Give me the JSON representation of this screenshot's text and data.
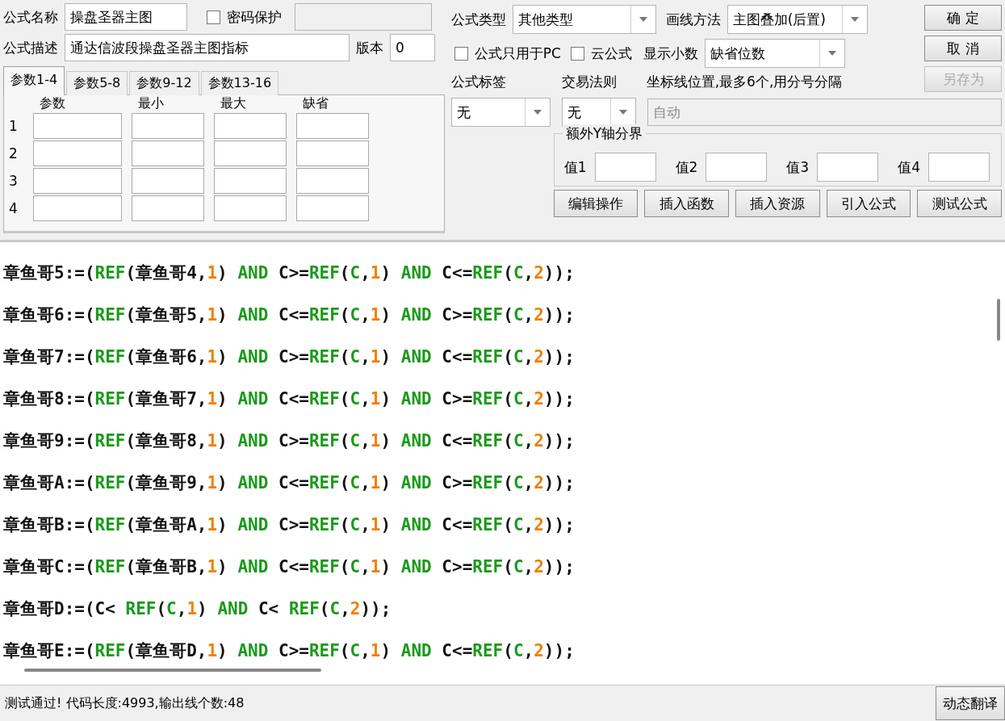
{
  "formula_name": {
    "label": "公式名称",
    "value": "操盘圣器主图"
  },
  "password": {
    "label": "密码保护",
    "checked": false,
    "disabled": true
  },
  "description": {
    "label": "公式描述",
    "value": "通达信波段操盘圣器主图指标"
  },
  "version": {
    "label": "版本",
    "value": "0"
  },
  "tabs": [
    {
      "label": "参数1-4",
      "selected": true
    },
    {
      "label": "参数5-8",
      "selected": false
    },
    {
      "label": "参数9-12",
      "selected": false
    },
    {
      "label": "参数13-16",
      "selected": false
    }
  ],
  "param_columns": [
    "参数",
    "最小",
    "最大",
    "缺省"
  ],
  "param_rows": [
    {
      "index": "1"
    },
    {
      "index": "2"
    },
    {
      "index": "3"
    },
    {
      "index": "4"
    }
  ],
  "formula_type": {
    "label": "公式类型",
    "value": "其他类型"
  },
  "draw_method": {
    "label": "画线方法",
    "value": "主图叠加(后置)"
  },
  "options": [
    {
      "label": "公式只用于PC",
      "checked": false
    },
    {
      "label": "云公式",
      "checked": false
    }
  ],
  "decimals": {
    "label": "显示小数",
    "value": "缺省位数"
  },
  "dialog_buttons": [
    {
      "label": "确 定",
      "disabled": false
    },
    {
      "label": "取 消",
      "disabled": false
    },
    {
      "label": "另存为",
      "disabled": true
    }
  ],
  "formula_tag": {
    "label": "公式标签",
    "value": "无"
  },
  "trade_rule": {
    "label": "交易法则",
    "value": "无"
  },
  "axis_lines": {
    "label": "坐标线位置,最多6个,用分号分隔",
    "placeholder": "自动",
    "disabled": true
  },
  "y_bounds": {
    "title": "额外Y轴分界",
    "fields": [
      {
        "label": "值1"
      },
      {
        "label": "值2"
      },
      {
        "label": "值3"
      },
      {
        "label": "值4"
      }
    ]
  },
  "tool_buttons": [
    "编辑操作",
    "插入函数",
    "插入资源",
    "引入公式",
    "测试公式"
  ],
  "code_lines": [
    {
      "segments": [
        {
          "kind": "plain",
          "text": "章鱼哥5:=("
        },
        {
          "kind": "func",
          "text": "REF"
        },
        {
          "kind": "plain",
          "text": "(章鱼哥4,"
        },
        {
          "kind": "num",
          "text": "1"
        },
        {
          "kind": "plain",
          "text": ") "
        },
        {
          "kind": "func",
          "text": "AND"
        },
        {
          "kind": "plain",
          "text": " C>="
        },
        {
          "kind": "func",
          "text": "REF"
        },
        {
          "kind": "plain",
          "text": "("
        },
        {
          "kind": "func",
          "text": "C"
        },
        {
          "kind": "plain",
          "text": ","
        },
        {
          "kind": "num",
          "text": "1"
        },
        {
          "kind": "plain",
          "text": ") "
        },
        {
          "kind": "func",
          "text": "AND"
        },
        {
          "kind": "plain",
          "text": " C<="
        },
        {
          "kind": "func",
          "text": "REF"
        },
        {
          "kind": "plain",
          "text": "("
        },
        {
          "kind": "func",
          "text": "C"
        },
        {
          "kind": "plain",
          "text": ","
        },
        {
          "kind": "num",
          "text": "2"
        },
        {
          "kind": "plain",
          "text": "));"
        }
      ]
    },
    {
      "segments": [
        {
          "kind": "plain",
          "text": "章鱼哥6:=("
        },
        {
          "kind": "func",
          "text": "REF"
        },
        {
          "kind": "plain",
          "text": "(章鱼哥5,"
        },
        {
          "kind": "num",
          "text": "1"
        },
        {
          "kind": "plain",
          "text": ") "
        },
        {
          "kind": "func",
          "text": "AND"
        },
        {
          "kind": "plain",
          "text": " C<="
        },
        {
          "kind": "func",
          "text": "REF"
        },
        {
          "kind": "plain",
          "text": "("
        },
        {
          "kind": "func",
          "text": "C"
        },
        {
          "kind": "plain",
          "text": ","
        },
        {
          "kind": "num",
          "text": "1"
        },
        {
          "kind": "plain",
          "text": ") "
        },
        {
          "kind": "func",
          "text": "AND"
        },
        {
          "kind": "plain",
          "text": " C>="
        },
        {
          "kind": "func",
          "text": "REF"
        },
        {
          "kind": "plain",
          "text": "("
        },
        {
          "kind": "func",
          "text": "C"
        },
        {
          "kind": "plain",
          "text": ","
        },
        {
          "kind": "num",
          "text": "2"
        },
        {
          "kind": "plain",
          "text": "));"
        }
      ]
    },
    {
      "segments": [
        {
          "kind": "plain",
          "text": "章鱼哥7:=("
        },
        {
          "kind": "func",
          "text": "REF"
        },
        {
          "kind": "plain",
          "text": "(章鱼哥6,"
        },
        {
          "kind": "num",
          "text": "1"
        },
        {
          "kind": "plain",
          "text": ") "
        },
        {
          "kind": "func",
          "text": "AND"
        },
        {
          "kind": "plain",
          "text": " C>="
        },
        {
          "kind": "func",
          "text": "REF"
        },
        {
          "kind": "plain",
          "text": "("
        },
        {
          "kind": "func",
          "text": "C"
        },
        {
          "kind": "plain",
          "text": ","
        },
        {
          "kind": "num",
          "text": "1"
        },
        {
          "kind": "plain",
          "text": ") "
        },
        {
          "kind": "func",
          "text": "AND"
        },
        {
          "kind": "plain",
          "text": " C<="
        },
        {
          "kind": "func",
          "text": "REF"
        },
        {
          "kind": "plain",
          "text": "("
        },
        {
          "kind": "func",
          "text": "C"
        },
        {
          "kind": "plain",
          "text": ","
        },
        {
          "kind": "num",
          "text": "2"
        },
        {
          "kind": "plain",
          "text": "));"
        }
      ]
    },
    {
      "segments": [
        {
          "kind": "plain",
          "text": "章鱼哥8:=("
        },
        {
          "kind": "func",
          "text": "REF"
        },
        {
          "kind": "plain",
          "text": "(章鱼哥7,"
        },
        {
          "kind": "num",
          "text": "1"
        },
        {
          "kind": "plain",
          "text": ") "
        },
        {
          "kind": "func",
          "text": "AND"
        },
        {
          "kind": "plain",
          "text": " C<="
        },
        {
          "kind": "func",
          "text": "REF"
        },
        {
          "kind": "plain",
          "text": "("
        },
        {
          "kind": "func",
          "text": "C"
        },
        {
          "kind": "plain",
          "text": ","
        },
        {
          "kind": "num",
          "text": "1"
        },
        {
          "kind": "plain",
          "text": ") "
        },
        {
          "kind": "func",
          "text": "AND"
        },
        {
          "kind": "plain",
          "text": " C>="
        },
        {
          "kind": "func",
          "text": "REF"
        },
        {
          "kind": "plain",
          "text": "("
        },
        {
          "kind": "func",
          "text": "C"
        },
        {
          "kind": "plain",
          "text": ","
        },
        {
          "kind": "num",
          "text": "2"
        },
        {
          "kind": "plain",
          "text": "));"
        }
      ]
    },
    {
      "segments": [
        {
          "kind": "plain",
          "text": "章鱼哥9:=("
        },
        {
          "kind": "func",
          "text": "REF"
        },
        {
          "kind": "plain",
          "text": "(章鱼哥8,"
        },
        {
          "kind": "num",
          "text": "1"
        },
        {
          "kind": "plain",
          "text": ") "
        },
        {
          "kind": "func",
          "text": "AND"
        },
        {
          "kind": "plain",
          "text": " C>="
        },
        {
          "kind": "func",
          "text": "REF"
        },
        {
          "kind": "plain",
          "text": "("
        },
        {
          "kind": "func",
          "text": "C"
        },
        {
          "kind": "plain",
          "text": ","
        },
        {
          "kind": "num",
          "text": "1"
        },
        {
          "kind": "plain",
          "text": ") "
        },
        {
          "kind": "func",
          "text": "AND"
        },
        {
          "kind": "plain",
          "text": " C<="
        },
        {
          "kind": "func",
          "text": "REF"
        },
        {
          "kind": "plain",
          "text": "("
        },
        {
          "kind": "func",
          "text": "C"
        },
        {
          "kind": "plain",
          "text": ","
        },
        {
          "kind": "num",
          "text": "2"
        },
        {
          "kind": "plain",
          "text": "));"
        }
      ]
    },
    {
      "segments": [
        {
          "kind": "plain",
          "text": "章鱼哥A:=("
        },
        {
          "kind": "func",
          "text": "REF"
        },
        {
          "kind": "plain",
          "text": "(章鱼哥9,"
        },
        {
          "kind": "num",
          "text": "1"
        },
        {
          "kind": "plain",
          "text": ") "
        },
        {
          "kind": "func",
          "text": "AND"
        },
        {
          "kind": "plain",
          "text": " C<="
        },
        {
          "kind": "func",
          "text": "REF"
        },
        {
          "kind": "plain",
          "text": "("
        },
        {
          "kind": "func",
          "text": "C"
        },
        {
          "kind": "plain",
          "text": ","
        },
        {
          "kind": "num",
          "text": "1"
        },
        {
          "kind": "plain",
          "text": ") "
        },
        {
          "kind": "func",
          "text": "AND"
        },
        {
          "kind": "plain",
          "text": " C>="
        },
        {
          "kind": "func",
          "text": "REF"
        },
        {
          "kind": "plain",
          "text": "("
        },
        {
          "kind": "func",
          "text": "C"
        },
        {
          "kind": "plain",
          "text": ","
        },
        {
          "kind": "num",
          "text": "2"
        },
        {
          "kind": "plain",
          "text": "));"
        }
      ]
    },
    {
      "segments": [
        {
          "kind": "plain",
          "text": "章鱼哥B:=("
        },
        {
          "kind": "func",
          "text": "REF"
        },
        {
          "kind": "plain",
          "text": "(章鱼哥A,"
        },
        {
          "kind": "num",
          "text": "1"
        },
        {
          "kind": "plain",
          "text": ") "
        },
        {
          "kind": "func",
          "text": "AND"
        },
        {
          "kind": "plain",
          "text": " C>="
        },
        {
          "kind": "func",
          "text": "REF"
        },
        {
          "kind": "plain",
          "text": "("
        },
        {
          "kind": "func",
          "text": "C"
        },
        {
          "kind": "plain",
          "text": ","
        },
        {
          "kind": "num",
          "text": "1"
        },
        {
          "kind": "plain",
          "text": ") "
        },
        {
          "kind": "func",
          "text": "AND"
        },
        {
          "kind": "plain",
          "text": " C<="
        },
        {
          "kind": "func",
          "text": "REF"
        },
        {
          "kind": "plain",
          "text": "("
        },
        {
          "kind": "func",
          "text": "C"
        },
        {
          "kind": "plain",
          "text": ","
        },
        {
          "kind": "num",
          "text": "2"
        },
        {
          "kind": "plain",
          "text": "));"
        }
      ]
    },
    {
      "segments": [
        {
          "kind": "plain",
          "text": "章鱼哥C:=("
        },
        {
          "kind": "func",
          "text": "REF"
        },
        {
          "kind": "plain",
          "text": "(章鱼哥B,"
        },
        {
          "kind": "num",
          "text": "1"
        },
        {
          "kind": "plain",
          "text": ") "
        },
        {
          "kind": "func",
          "text": "AND"
        },
        {
          "kind": "plain",
          "text": " C<="
        },
        {
          "kind": "func",
          "text": "REF"
        },
        {
          "kind": "plain",
          "text": "("
        },
        {
          "kind": "func",
          "text": "C"
        },
        {
          "kind": "plain",
          "text": ","
        },
        {
          "kind": "num",
          "text": "1"
        },
        {
          "kind": "plain",
          "text": ") "
        },
        {
          "kind": "func",
          "text": "AND"
        },
        {
          "kind": "plain",
          "text": " C>="
        },
        {
          "kind": "func",
          "text": "REF"
        },
        {
          "kind": "plain",
          "text": "("
        },
        {
          "kind": "func",
          "text": "C"
        },
        {
          "kind": "plain",
          "text": ","
        },
        {
          "kind": "num",
          "text": "2"
        },
        {
          "kind": "plain",
          "text": "));"
        }
      ]
    },
    {
      "segments": [
        {
          "kind": "plain",
          "text": "章鱼哥D:=(C< "
        },
        {
          "kind": "func",
          "text": "REF"
        },
        {
          "kind": "plain",
          "text": "("
        },
        {
          "kind": "func",
          "text": "C"
        },
        {
          "kind": "plain",
          "text": ","
        },
        {
          "kind": "num",
          "text": "1"
        },
        {
          "kind": "plain",
          "text": ") "
        },
        {
          "kind": "func",
          "text": "AND"
        },
        {
          "kind": "plain",
          "text": " C< "
        },
        {
          "kind": "func",
          "text": "REF"
        },
        {
          "kind": "plain",
          "text": "("
        },
        {
          "kind": "func",
          "text": "C"
        },
        {
          "kind": "plain",
          "text": ","
        },
        {
          "kind": "num",
          "text": "2"
        },
        {
          "kind": "plain",
          "text": "));"
        }
      ]
    },
    {
      "segments": [
        {
          "kind": "plain",
          "text": "章鱼哥E:=("
        },
        {
          "kind": "func",
          "text": "REF"
        },
        {
          "kind": "plain",
          "text": "(章鱼哥D,"
        },
        {
          "kind": "num",
          "text": "1"
        },
        {
          "kind": "plain",
          "text": ") "
        },
        {
          "kind": "func",
          "text": "AND"
        },
        {
          "kind": "plain",
          "text": " C>="
        },
        {
          "kind": "func",
          "text": "REF"
        },
        {
          "kind": "plain",
          "text": "("
        },
        {
          "kind": "func",
          "text": "C"
        },
        {
          "kind": "plain",
          "text": ","
        },
        {
          "kind": "num",
          "text": "1"
        },
        {
          "kind": "plain",
          "text": ") "
        },
        {
          "kind": "func",
          "text": "AND"
        },
        {
          "kind": "plain",
          "text": " C<="
        },
        {
          "kind": "func",
          "text": "REF"
        },
        {
          "kind": "plain",
          "text": "("
        },
        {
          "kind": "func",
          "text": "C"
        },
        {
          "kind": "plain",
          "text": ","
        },
        {
          "kind": "num",
          "text": "2"
        },
        {
          "kind": "plain",
          "text": "));"
        }
      ]
    }
  ],
  "status": {
    "text": "测试通过! 代码长度:4993,输出线个数:48",
    "button": "动态翻译"
  }
}
